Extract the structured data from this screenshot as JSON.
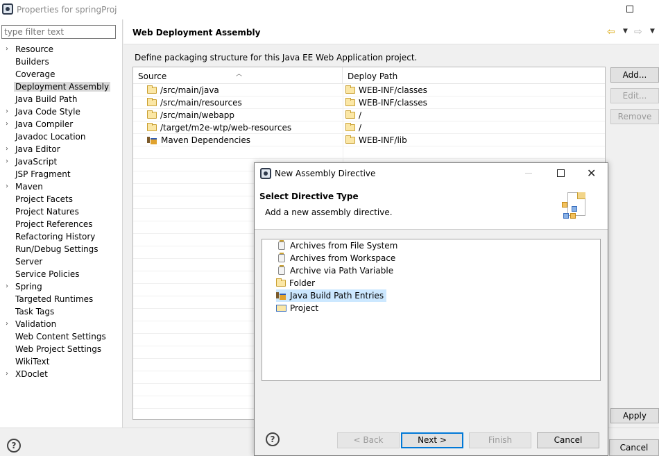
{
  "window": {
    "title": "Properties for springProj"
  },
  "filter": {
    "placeholder": "type filter text"
  },
  "nav_tree": [
    {
      "label": "Resource",
      "expandable": true
    },
    {
      "label": "Builders",
      "expandable": false
    },
    {
      "label": "Coverage",
      "expandable": false
    },
    {
      "label": "Deployment Assembly",
      "expandable": false,
      "selected": true
    },
    {
      "label": "Java Build Path",
      "expandable": false
    },
    {
      "label": "Java Code Style",
      "expandable": true
    },
    {
      "label": "Java Compiler",
      "expandable": true
    },
    {
      "label": "Javadoc Location",
      "expandable": false
    },
    {
      "label": "Java Editor",
      "expandable": true
    },
    {
      "label": "JavaScript",
      "expandable": true
    },
    {
      "label": "JSP Fragment",
      "expandable": false
    },
    {
      "label": "Maven",
      "expandable": true
    },
    {
      "label": "Project Facets",
      "expandable": false
    },
    {
      "label": "Project Natures",
      "expandable": false
    },
    {
      "label": "Project References",
      "expandable": false
    },
    {
      "label": "Refactoring History",
      "expandable": false
    },
    {
      "label": "Run/Debug Settings",
      "expandable": false
    },
    {
      "label": "Server",
      "expandable": false
    },
    {
      "label": "Service Policies",
      "expandable": false
    },
    {
      "label": "Spring",
      "expandable": true
    },
    {
      "label": "Targeted Runtimes",
      "expandable": false
    },
    {
      "label": "Task Tags",
      "expandable": false
    },
    {
      "label": "Validation",
      "expandable": true
    },
    {
      "label": "Web Content Settings",
      "expandable": false
    },
    {
      "label": "Web Project Settings",
      "expandable": false
    },
    {
      "label": "WikiText",
      "expandable": false
    },
    {
      "label": "XDoclet",
      "expandable": true
    }
  ],
  "page": {
    "title": "Web Deployment Assembly",
    "description": "Define packaging structure for this Java EE Web Application project.",
    "columns": {
      "source": "Source",
      "deploy": "Deploy Path"
    },
    "rows": [
      {
        "source": "/src/main/java",
        "deploy": "WEB-INF/classes",
        "icon": "folder-icon"
      },
      {
        "source": "/src/main/resources",
        "deploy": "WEB-INF/classes",
        "icon": "folder-icon"
      },
      {
        "source": "/src/main/webapp",
        "deploy": "/",
        "icon": "folder-icon"
      },
      {
        "source": "/target/m2e-wtp/web-resources",
        "deploy": "/",
        "icon": "folder-icon"
      },
      {
        "source": "Maven Dependencies",
        "deploy": "WEB-INF/lib",
        "icon": "library-icon"
      }
    ],
    "buttons": {
      "add": "Add...",
      "edit": "Edit...",
      "remove": "Remove",
      "apply": "Apply"
    }
  },
  "footer": {
    "cancel": "Cancel"
  },
  "dialog": {
    "title": "New Assembly Directive",
    "heading": "Select Directive Type",
    "subheading": "Add a new assembly directive.",
    "items": [
      {
        "label": "Archives from File System",
        "icon": "jar-icon"
      },
      {
        "label": "Archives from Workspace",
        "icon": "jar-icon"
      },
      {
        "label": "Archive via Path Variable",
        "icon": "jar-icon"
      },
      {
        "label": "Folder",
        "icon": "folder-icon"
      },
      {
        "label": "Java Build Path Entries",
        "icon": "library-icon",
        "selected": true
      },
      {
        "label": "Project",
        "icon": "project-icon"
      }
    ],
    "buttons": {
      "back": "< Back",
      "next": "Next >",
      "finish": "Finish",
      "cancel": "Cancel"
    }
  },
  "colors": {
    "selection": "#cce8ff",
    "tree_selection": "#d9d9d9",
    "default_button_border": "#0078d7"
  }
}
